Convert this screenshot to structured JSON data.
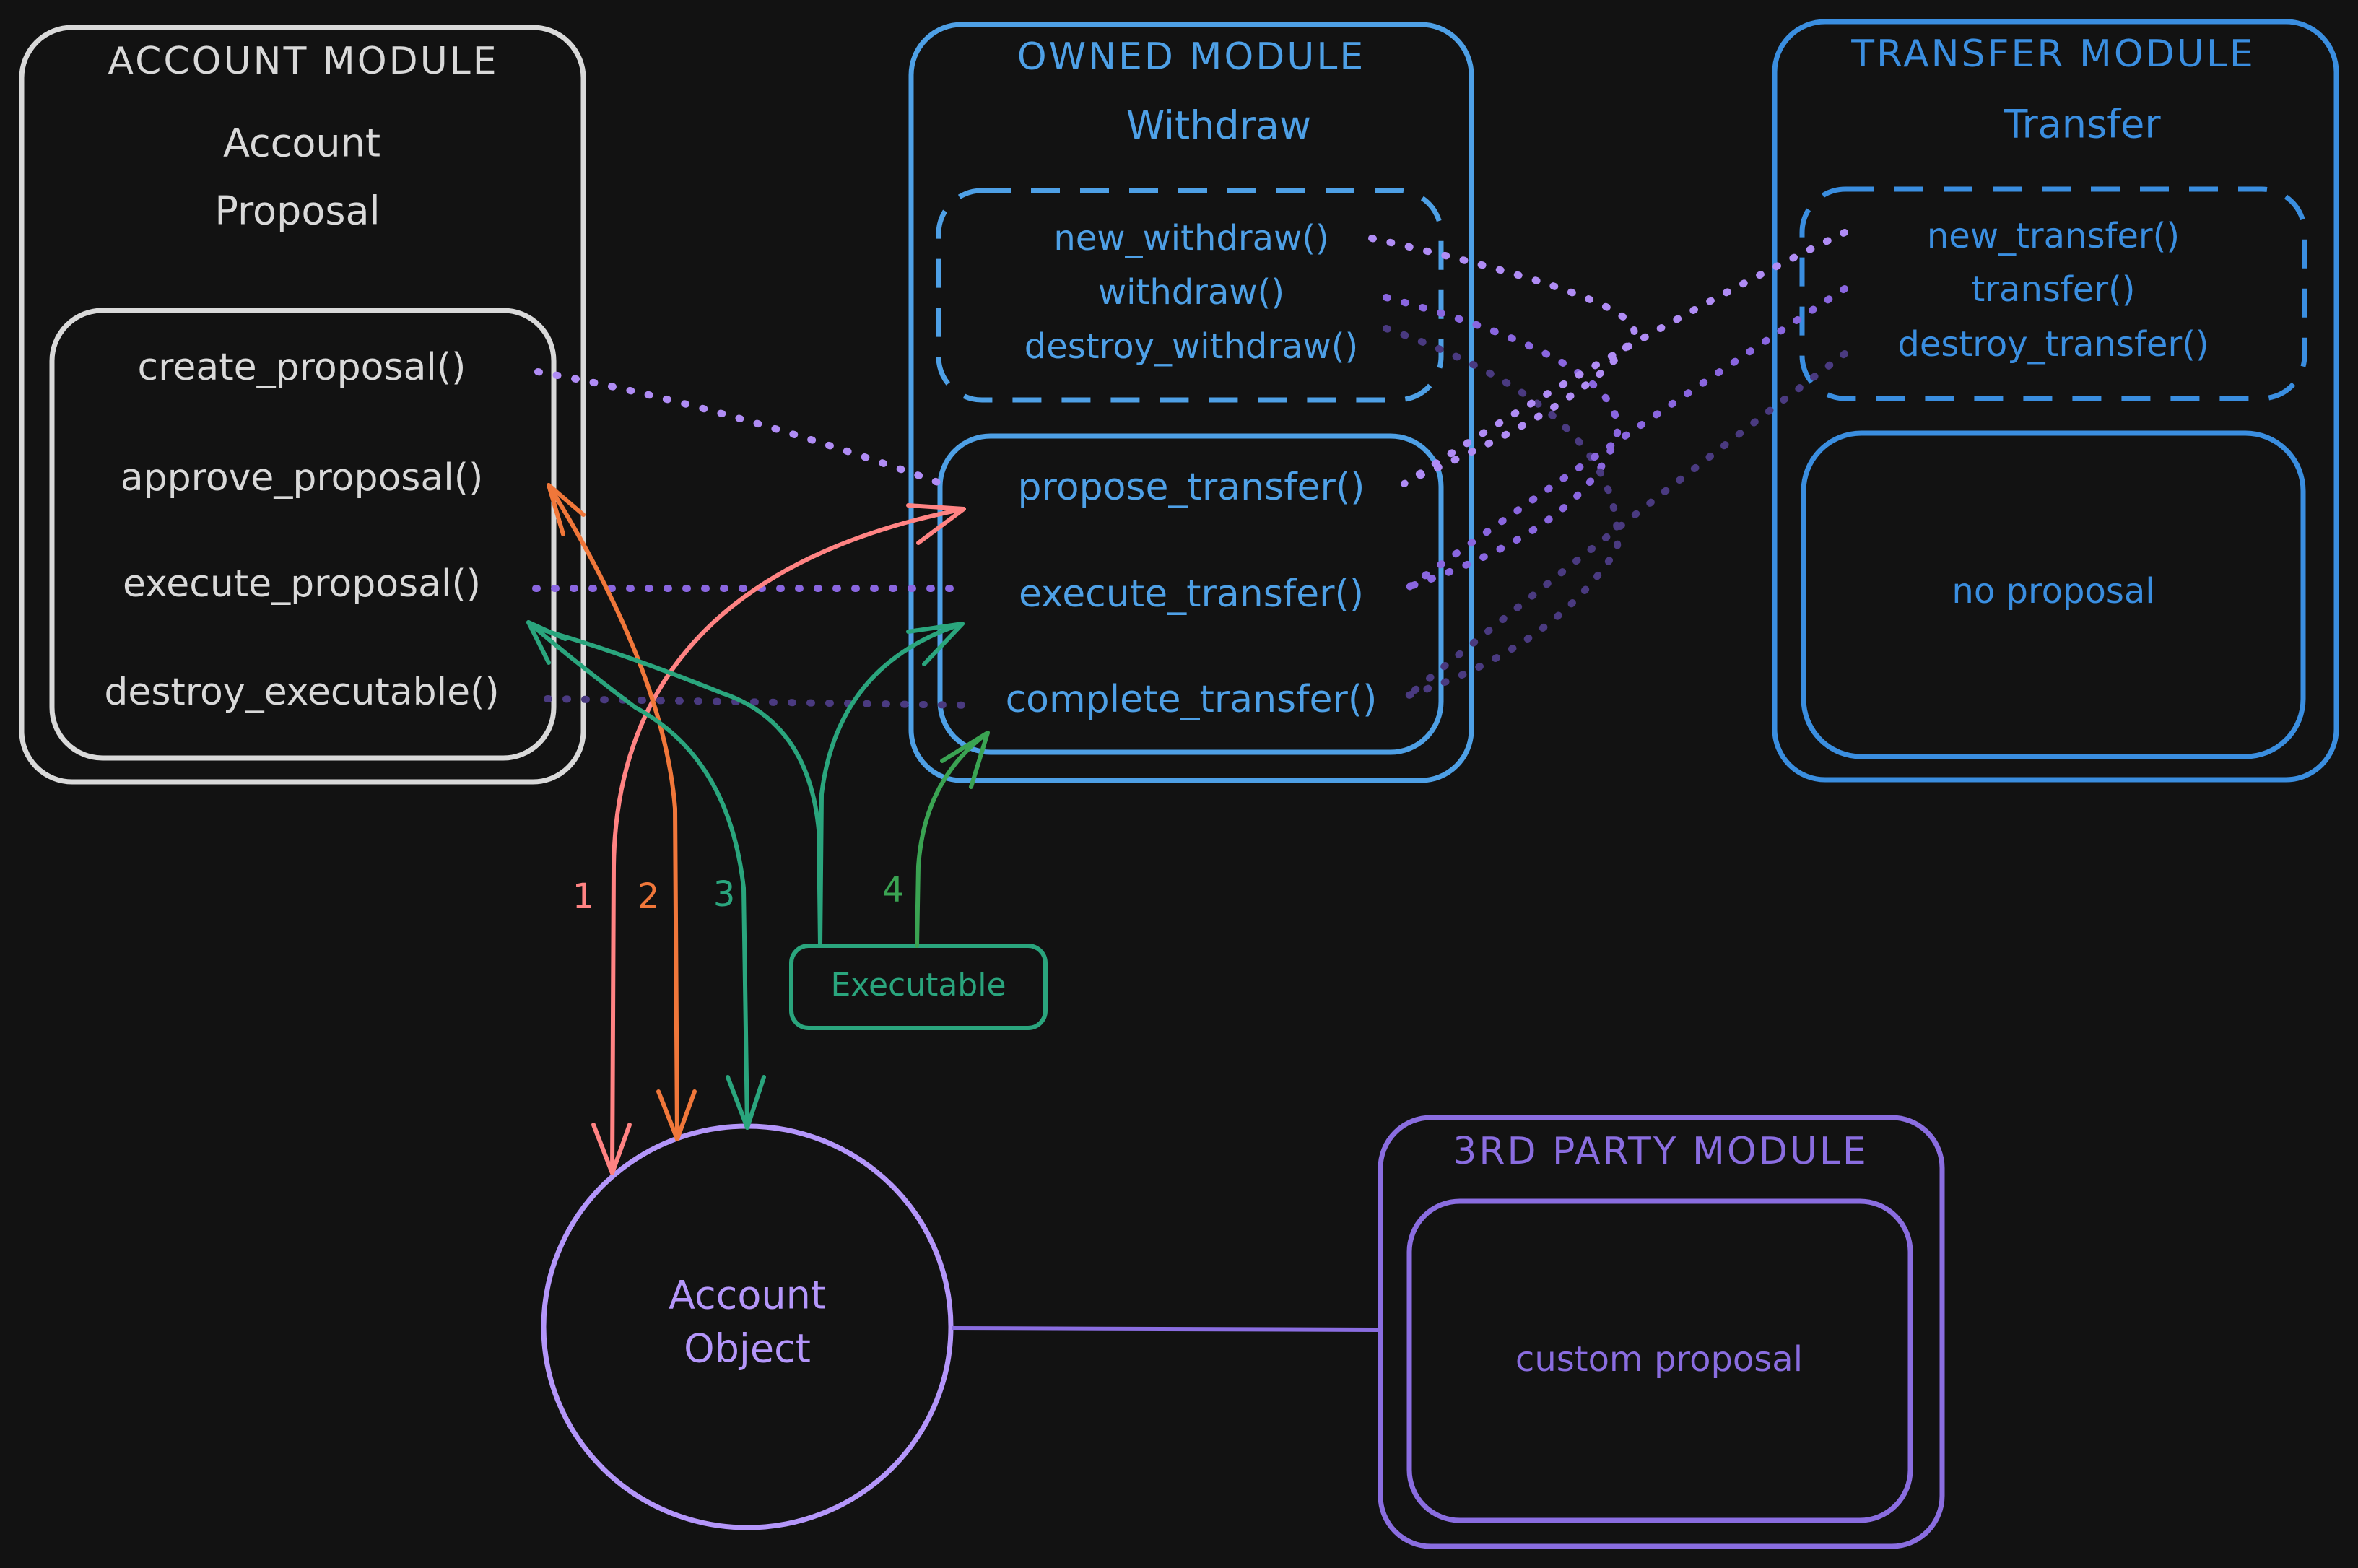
{
  "colors": {
    "background": "#121212",
    "account_module": "#d9d9d9",
    "owned_module": "#4ea0e6",
    "transfer_module": "#3a8ee0",
    "third_party": "#8a6de0",
    "account_object": "#b496fa",
    "arrow_1": "#ff8383",
    "arrow_2": "#f0773a",
    "arrow_3": "#2aa57d",
    "arrow_4": "#3aa352",
    "executable": "#2aa57d",
    "link_light": "#b08cf5",
    "link_mid": "#8a66e0",
    "link_dark": "#4a3a80"
  },
  "account_module": {
    "title": "ACCOUNT MODULE",
    "subtitle_1": "Account",
    "subtitle_2": "Proposal",
    "functions": [
      "create_proposal()",
      "approve_proposal()",
      "execute_proposal()",
      "destroy_executable()"
    ]
  },
  "owned_module": {
    "title": "OWNED MODULE",
    "subtitle": "Withdraw",
    "intent_functions": [
      "new_withdraw()",
      "withdraw()",
      "destroy_withdraw()"
    ],
    "proposal_functions": [
      "propose_transfer()",
      "execute_transfer()",
      "complete_transfer()"
    ]
  },
  "transfer_module": {
    "title": "TRANSFER MODULE",
    "subtitle": "Transfer",
    "intent_functions": [
      "new_transfer()",
      "transfer()",
      "destroy_transfer()"
    ],
    "proposal_label": "no proposal"
  },
  "third_party_module": {
    "title": "3RD PARTY MODULE",
    "proposal_label": "custom proposal"
  },
  "account_object": {
    "line_1": "Account",
    "line_2": "Object"
  },
  "executable": {
    "label": "Executable"
  },
  "flow_labels": [
    "1",
    "2",
    "3",
    "4"
  ]
}
